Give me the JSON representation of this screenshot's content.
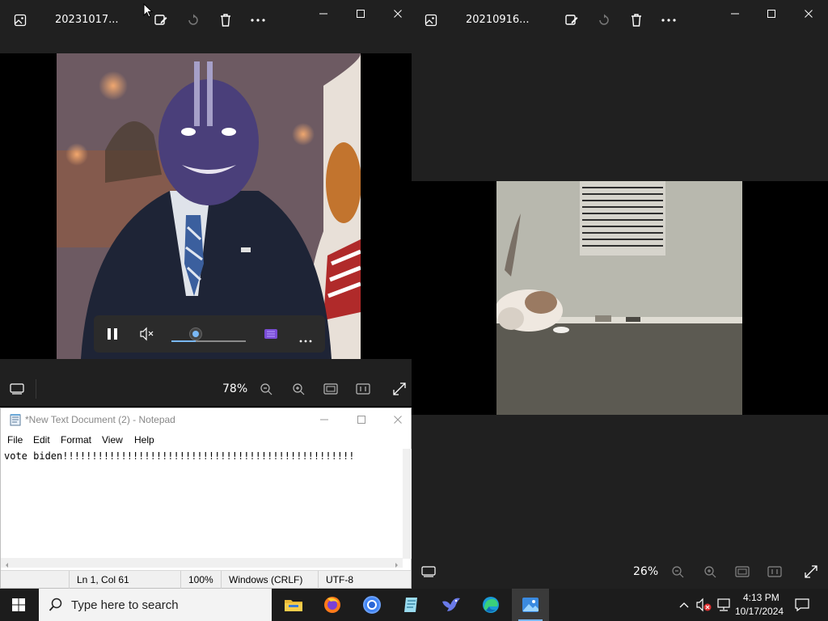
{
  "left_photo": {
    "title": "20231017...",
    "zoom": "78%"
  },
  "right_photo": {
    "title": "20210916...",
    "zoom": "26%"
  },
  "player": {
    "volume_level": 0.33
  },
  "notepad": {
    "title": "*New Text Document (2) - Notepad",
    "menu": [
      "File",
      "Edit",
      "Format",
      "View",
      "Help"
    ],
    "content": "vote biden!!!!!!!!!!!!!!!!!!!!!!!!!!!!!!!!!!!!!!!!!!!!!!!!!!",
    "status": {
      "position": "Ln 1, Col 61",
      "zoom": "100%",
      "line_ending": "Windows (CRLF)",
      "encoding": "UTF-8"
    }
  },
  "taskbar": {
    "search_placeholder": "Type here to search",
    "time": "4:13 PM",
    "date": "10/17/2024",
    "apps": [
      "file-explorer-icon",
      "firefox-icon",
      "chrome-icon",
      "notepad-icon",
      "bird-app-icon",
      "edge-icon",
      "photos-icon"
    ]
  },
  "colors": {
    "window_bg": "#202020",
    "taskbar_bg": "#1c1c1c",
    "accent": "#7ab8f5"
  }
}
